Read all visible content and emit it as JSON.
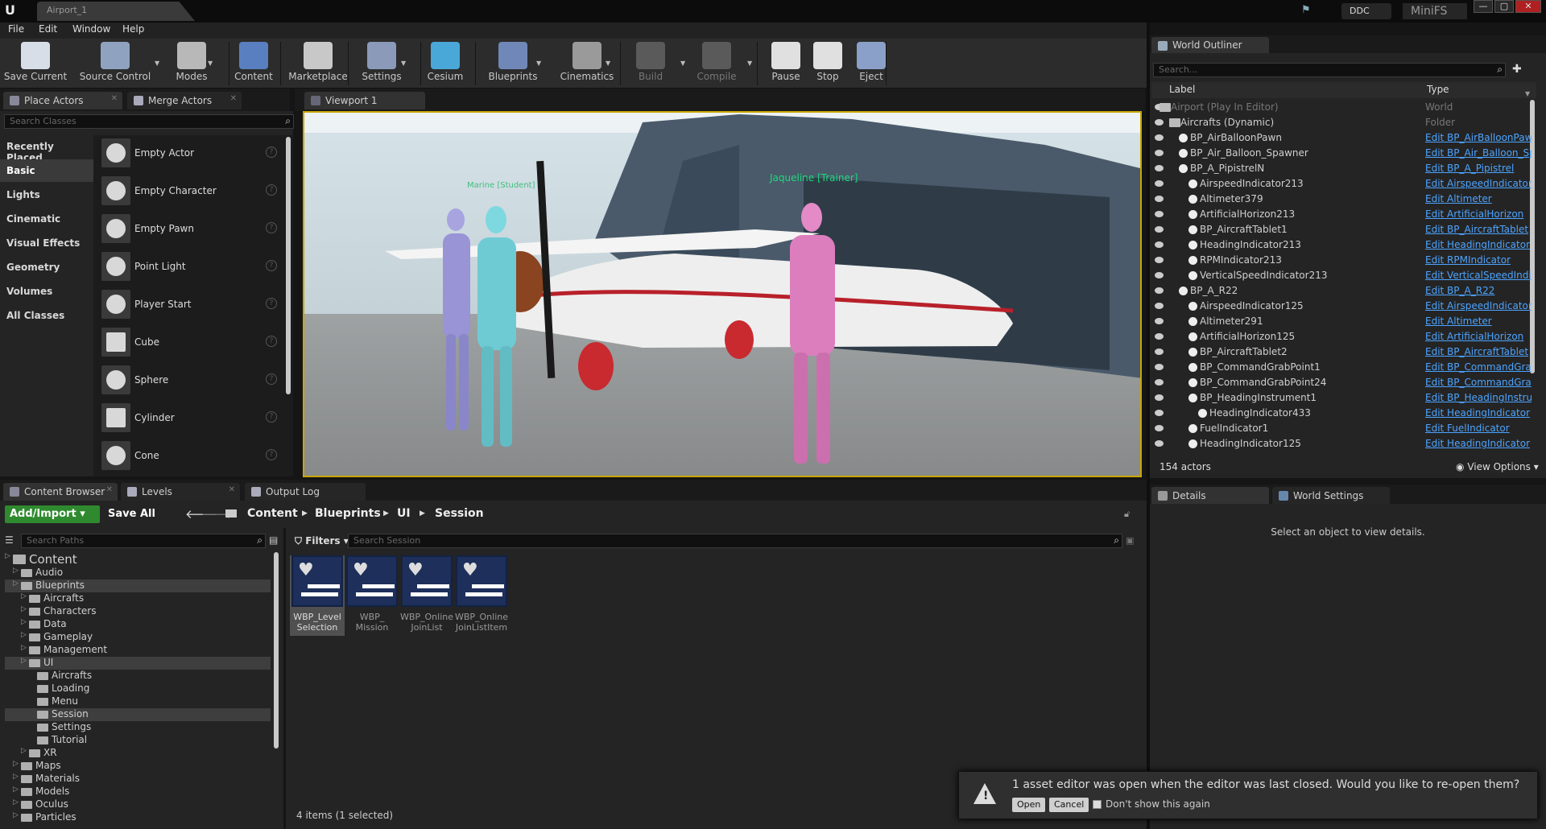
{
  "titlebar": {
    "doc_tab": "Airport_1",
    "ddc": "DDC",
    "minifs": "MiniFS",
    "min": "—",
    "max": "▢",
    "close": "✕"
  },
  "menu": [
    "File",
    "Edit",
    "Window",
    "Help"
  ],
  "toolbar": [
    {
      "label": "Save Current",
      "icon": "save-icon",
      "color": "#d8dee8"
    },
    {
      "label": "Source Control",
      "icon": "source-control-icon",
      "color": "#8fa3c0"
    },
    {
      "label": "Modes",
      "icon": "modes-icon",
      "color": "#b8b8b8"
    },
    {
      "label": "Content",
      "icon": "content-icon",
      "color": "#5a7fc0"
    },
    {
      "label": "Marketplace",
      "icon": "marketplace-icon",
      "color": "#c8c8c8"
    },
    {
      "label": "Settings",
      "icon": "settings-icon",
      "color": "#8a9ab8"
    },
    {
      "label": "Cesium",
      "icon": "cesium-icon",
      "color": "#4aa8d8"
    },
    {
      "label": "Blueprints",
      "icon": "blueprints-icon",
      "color": "#7088b8"
    },
    {
      "label": "Cinematics",
      "icon": "cinematics-icon",
      "color": "#9a9a9a"
    },
    {
      "label": "Build",
      "icon": "build-icon",
      "color": "#5a5a5a"
    },
    {
      "label": "Compile",
      "icon": "compile-icon",
      "color": "#5a5a5a"
    },
    {
      "label": "Pause",
      "icon": "pause-icon",
      "color": "#e0e0e0"
    },
    {
      "label": "Stop",
      "icon": "stop-icon",
      "color": "#e0e0e0"
    },
    {
      "label": "Eject",
      "icon": "eject-icon",
      "color": "#8aa0c8"
    }
  ],
  "place_actors": {
    "tab1": "Place Actors",
    "tab2": "Merge Actors",
    "search_placeholder": "Search Classes",
    "categories": [
      "Recently Placed",
      "Basic",
      "Lights",
      "Cinematic",
      "Visual Effects",
      "Geometry",
      "Volumes",
      "All Classes"
    ],
    "actors": [
      "Empty Actor",
      "Empty Character",
      "Empty Pawn",
      "Point Light",
      "Player Start",
      "Cube",
      "Sphere",
      "Cylinder",
      "Cone"
    ],
    "help": "?"
  },
  "viewport": {
    "tab": "Viewport 1",
    "label_student": "Marine [Student]",
    "label_trainer": "Jaqueline [Trainer]"
  },
  "outliner": {
    "tab": "World Outliner",
    "search_placeholder": "Search...",
    "col_label": "Label",
    "col_type": "Type",
    "rows": [
      {
        "label": "Airport (Play In Editor)",
        "type": "World"
      },
      {
        "label": "Aircrafts (Dynamic)",
        "type": "Folder"
      },
      {
        "label": "BP_AirBalloonPawn",
        "type": "Edit BP_AirBalloonPaw"
      },
      {
        "label": "BP_Air_Balloon_Spawner",
        "type": "Edit BP_Air_Balloon_Sp"
      },
      {
        "label": "BP_A_PipistrelN",
        "type": "Edit BP_A_Pipistrel"
      },
      {
        "label": "AirspeedIndicator213",
        "type": "Edit AirspeedIndicator"
      },
      {
        "label": "Altimeter379",
        "type": "Edit Altimeter"
      },
      {
        "label": "ArtificialHorizon213",
        "type": "Edit ArtificialHorizon"
      },
      {
        "label": "BP_AircraftTablet1",
        "type": "Edit BP_AircraftTablet"
      },
      {
        "label": "HeadingIndicator213",
        "type": "Edit HeadingIndicator"
      },
      {
        "label": "RPMIndicator213",
        "type": "Edit RPMIndicator"
      },
      {
        "label": "VerticalSpeedIndicator213",
        "type": "Edit VerticalSpeedIndi"
      },
      {
        "label": "BP_A_R22",
        "type": "Edit BP_A_R22"
      },
      {
        "label": "AirspeedIndicator125",
        "type": "Edit AirspeedIndicator"
      },
      {
        "label": "Altimeter291",
        "type": "Edit Altimeter"
      },
      {
        "label": "ArtificialHorizon125",
        "type": "Edit ArtificialHorizon"
      },
      {
        "label": "BP_AircraftTablet2",
        "type": "Edit BP_AircraftTablet"
      },
      {
        "label": "BP_CommandGrabPoint1",
        "type": "Edit BP_CommandGra"
      },
      {
        "label": "BP_CommandGrabPoint24",
        "type": "Edit BP_CommandGra"
      },
      {
        "label": "BP_HeadingInstrument1",
        "type": "Edit BP_HeadingInstru"
      },
      {
        "label": "HeadingIndicator433",
        "type": "Edit HeadingIndicator"
      },
      {
        "label": "FuelIndicator1",
        "type": "Edit FuelIndicator"
      },
      {
        "label": "HeadingIndicator125",
        "type": "Edit HeadingIndicator"
      }
    ],
    "actor_count": "154 actors",
    "view_options": "View Options"
  },
  "details": {
    "tab1": "Details",
    "tab2": "World Settings",
    "empty_msg": "Select an object to view details."
  },
  "content_browser": {
    "tab1": "Content Browser",
    "tab2": "Levels",
    "tab3": "Output Log",
    "add_import": "Add/Import",
    "save_all": "Save All",
    "breadcrumb": [
      "Content",
      "Blueprints",
      "UI",
      "Session"
    ],
    "search_paths": "Search Paths",
    "filters": "Filters",
    "search_session": "Search Session",
    "tree": [
      {
        "label": "Content",
        "depth": 0
      },
      {
        "label": "Audio",
        "depth": 1
      },
      {
        "label": "Blueprints",
        "depth": 1
      },
      {
        "label": "Aircrafts",
        "depth": 2
      },
      {
        "label": "Characters",
        "depth": 2
      },
      {
        "label": "Data",
        "depth": 2
      },
      {
        "label": "Gameplay",
        "depth": 2
      },
      {
        "label": "Management",
        "depth": 2
      },
      {
        "label": "UI",
        "depth": 2
      },
      {
        "label": "Aircrafts",
        "depth": 3
      },
      {
        "label": "Loading",
        "depth": 3
      },
      {
        "label": "Menu",
        "depth": 3
      },
      {
        "label": "Session",
        "depth": 3
      },
      {
        "label": "Settings",
        "depth": 3
      },
      {
        "label": "Tutorial",
        "depth": 3
      },
      {
        "label": "XR",
        "depth": 2
      },
      {
        "label": "Maps",
        "depth": 1
      },
      {
        "label": "Materials",
        "depth": 1
      },
      {
        "label": "Models",
        "depth": 1
      },
      {
        "label": "Oculus",
        "depth": 1
      },
      {
        "label": "Particles",
        "depth": 1
      }
    ],
    "assets": [
      {
        "line1": "WBP_Level",
        "line2": "Selection"
      },
      {
        "line1": "WBP_",
        "line2": "Mission"
      },
      {
        "line1": "WBP_Online",
        "line2": "JoinList"
      },
      {
        "line1": "WBP_Online",
        "line2": "JoinListItem"
      }
    ],
    "status": "4 items (1 selected)"
  },
  "notification": {
    "message": "1 asset editor was open when the editor was last closed. Would you like to re-open them?",
    "open": "Open",
    "cancel": "Cancel",
    "dont_show": "Don't show this again",
    "behind": "View Options"
  }
}
